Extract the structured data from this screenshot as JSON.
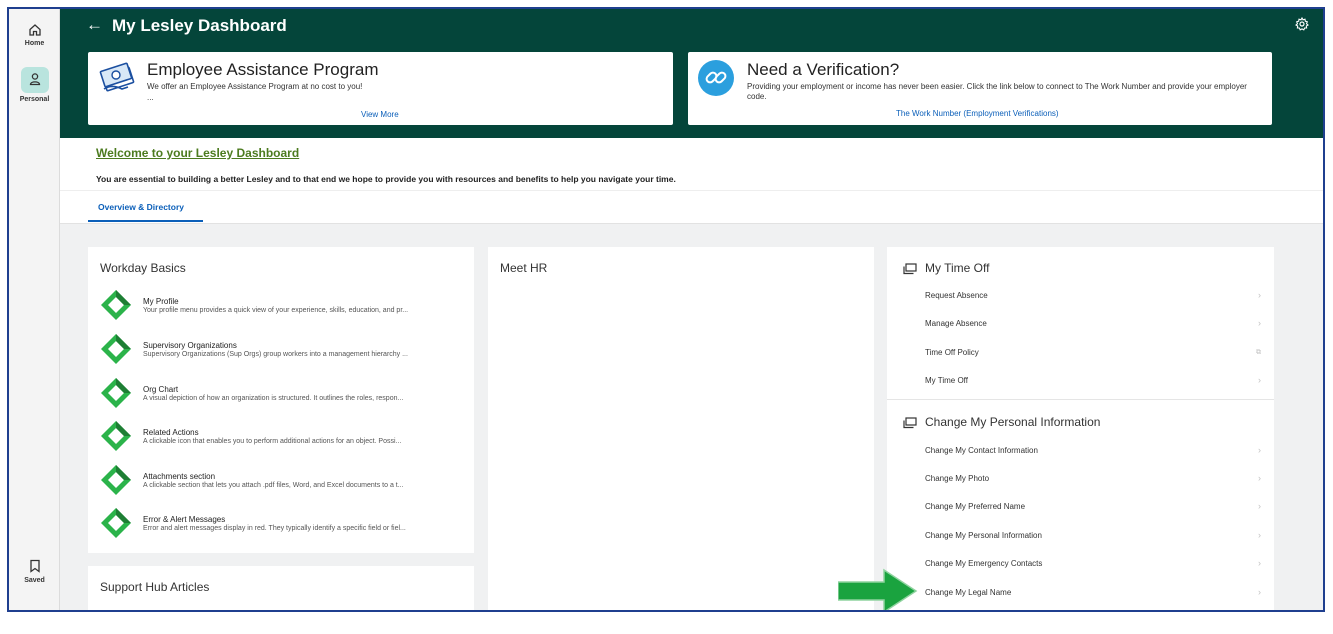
{
  "rail": {
    "home_label": "Home",
    "personal_label": "Personal",
    "saved_label": "Saved"
  },
  "header": {
    "title": "My Lesley Dashboard"
  },
  "promos": [
    {
      "title": "Employee Assistance Program",
      "desc": "We offer an Employee Assistance Program at no cost to you!",
      "ellipsis": "...",
      "link": "View More"
    },
    {
      "title": "Need a Verification?",
      "desc": "Providing your employment or income has never been easier. Click the link below to connect to The Work Number and provide your employer code.",
      "link": "The Work Number (Employment Verifications)"
    }
  ],
  "welcome": {
    "title": "Welcome to your Lesley Dashboard",
    "desc": "You are essential to building a better Lesley and to that end we hope to provide you with resources and benefits to help you navigate your time.",
    "tab": "Overview & Directory"
  },
  "workday_basics": {
    "title": "Workday Basics",
    "items": [
      {
        "name": "My Profile",
        "desc": "Your profile menu provides a quick view of your experience, skills, education, and pr..."
      },
      {
        "name": "Supervisory Organizations",
        "desc": "Supervisory Organizations (Sup Orgs) group workers into a management hierarchy ..."
      },
      {
        "name": "Org Chart",
        "desc": "A visual depiction of how an organization is structured. It outlines the roles, respon..."
      },
      {
        "name": "Related Actions",
        "desc": "A clickable icon that enables you to perform additional actions for an object. Possi..."
      },
      {
        "name": "Attachments section",
        "desc": "A clickable section that lets you attach .pdf files, Word, and Excel documents to a t..."
      },
      {
        "name": "Error & Alert Messages",
        "desc": "Error and alert messages display in red. They typically identify a specific field or fiel..."
      }
    ]
  },
  "support_hub": {
    "title": "Support Hub Articles"
  },
  "meet_hr": {
    "title": "Meet HR"
  },
  "time_off": {
    "title": "My Time Off",
    "items": [
      "Request Absence",
      "Manage Absence",
      "Time Off Policy",
      "My Time Off"
    ]
  },
  "personal_info": {
    "title": "Change My Personal Information",
    "items": [
      "Change My Contact Information",
      "Change My Photo",
      "Change My Preferred Name",
      "Change My Personal Information",
      "Change My Emergency Contacts",
      "Change My Legal Name"
    ]
  },
  "colors": {
    "header_green": "#04453a",
    "link_blue": "#0b5fb9",
    "welcome_green": "#4c7b1f",
    "arrow_green": "#1aa33f"
  }
}
